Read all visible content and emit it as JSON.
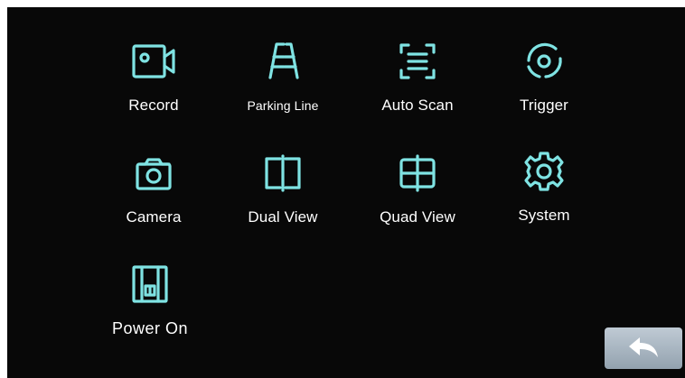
{
  "colors": {
    "background": "#080808",
    "icon_stroke": "#7fe3e3",
    "label_text": "#ffffff",
    "back_button": "#a9b6c2"
  },
  "menu": {
    "items": [
      {
        "label": "Record",
        "icon": "video-camera-icon"
      },
      {
        "label": "Parking Line",
        "icon": "parking-line-icon"
      },
      {
        "label": "Auto Scan",
        "icon": "scan-icon"
      },
      {
        "label": "Trigger",
        "icon": "trigger-icon"
      },
      {
        "label": "Camera",
        "icon": "camera-icon"
      },
      {
        "label": "Dual View",
        "icon": "dual-view-icon"
      },
      {
        "label": "Quad View",
        "icon": "quad-view-icon"
      },
      {
        "label": "System",
        "icon": "gear-icon"
      },
      {
        "label": "Power On",
        "icon": "power-on-icon"
      }
    ]
  },
  "back_button": {
    "icon": "back-arrow-icon"
  }
}
